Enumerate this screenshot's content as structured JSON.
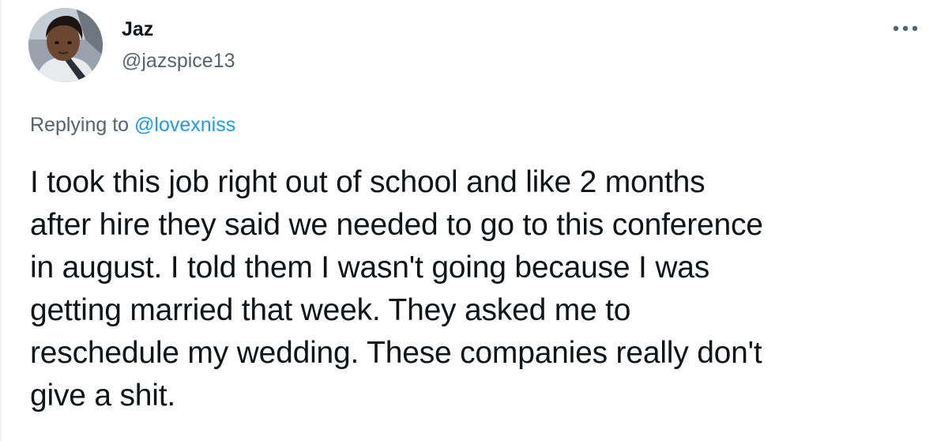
{
  "author": {
    "display_name": "Jaz",
    "handle": "@jazspice13",
    "avatar_icon": "profile-photo"
  },
  "menu": {
    "icon": "more-horizontal-icon"
  },
  "reply_context": {
    "prefix": "Replying to",
    "mention": "@lovexniss"
  },
  "tweet": {
    "text": "I took this job right out of school and like 2 months\nafter hire they said we needed to go to this conference\nin august. I told them I wasn't going because I was\ngetting married that week. They asked me to\nreschedule my wedding. These companies really don't\ngive a shit."
  },
  "colors": {
    "text": "#0f1419",
    "secondary_text": "#536471",
    "link": "#1d9bf0"
  }
}
